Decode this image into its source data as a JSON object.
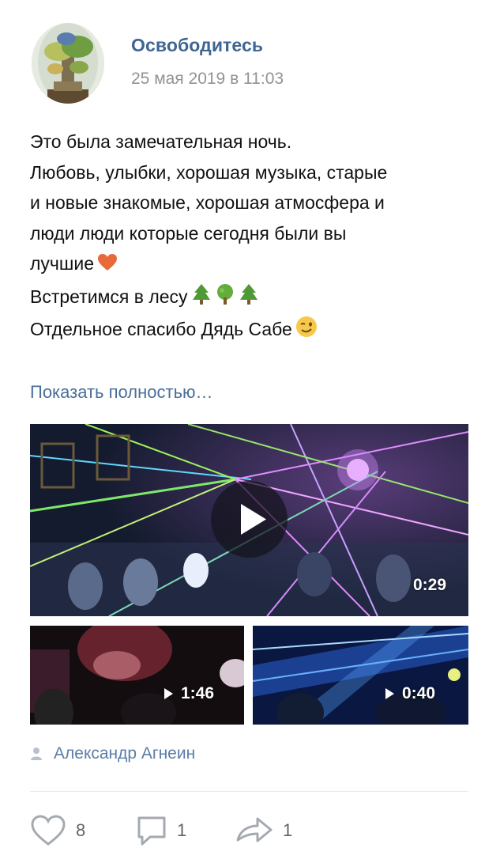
{
  "post": {
    "author": "Освободитесь",
    "date": "25 мая 2019 в 11:03",
    "text_lines": [
      "Это была замечательная ночь.",
      "Любовь, улыбки, хорошая музыка, старые",
      "и новые знакомые, хорошая атмосфера и",
      "люди люди которые сегодня были вы",
      "лучшие",
      "Встретимся в лесу",
      "Отдельное спасибо Дядь Сабе"
    ],
    "emojis": {
      "line5": "heart-emoji",
      "line6": [
        "tree-emoji",
        "deciduous-tree-emoji",
        "tree-emoji"
      ],
      "line7": "winking-face-emoji"
    },
    "show_more": "Показать полностью…",
    "signer": "Александр Агнеин"
  },
  "videos": [
    {
      "duration": "0:29"
    },
    {
      "duration": "1:46"
    },
    {
      "duration": "0:40"
    }
  ],
  "actions": {
    "likes": "8",
    "comments": "1",
    "shares": "1"
  },
  "colors": {
    "author": "#3f6591",
    "date": "#8f9398",
    "link": "#4a6f99",
    "icon": "#a5aab1"
  }
}
